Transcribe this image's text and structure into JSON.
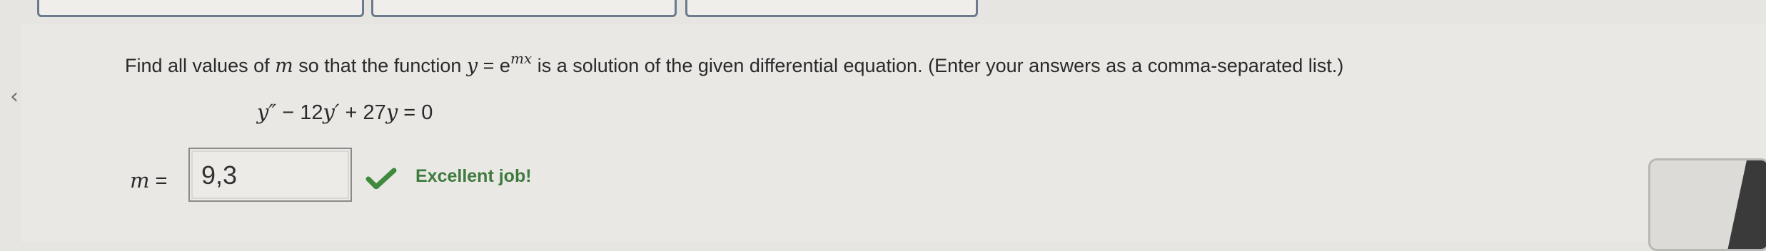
{
  "question": {
    "text_before_var": "Find all values of ",
    "var_m": "m",
    "text_mid": " so that the function ",
    "func_y": "y",
    "equals": " = e",
    "exponent": "mx",
    "text_after": " is a solution of the given differential equation. (Enter your answers as a comma-separated list.)"
  },
  "equation": {
    "y2": "y″",
    "minus12": " − 12",
    "y1": "y′",
    "plus27": " + 27",
    "y0": "y",
    "rhs": " = 0"
  },
  "answer": {
    "label_var": "m",
    "label_eq": " =",
    "value": "9,3"
  },
  "feedback": {
    "message": "Excellent job!",
    "status_color": "#3f8a3f"
  },
  "icons": {
    "check": "check-icon",
    "back": "chevron-left-icon"
  }
}
